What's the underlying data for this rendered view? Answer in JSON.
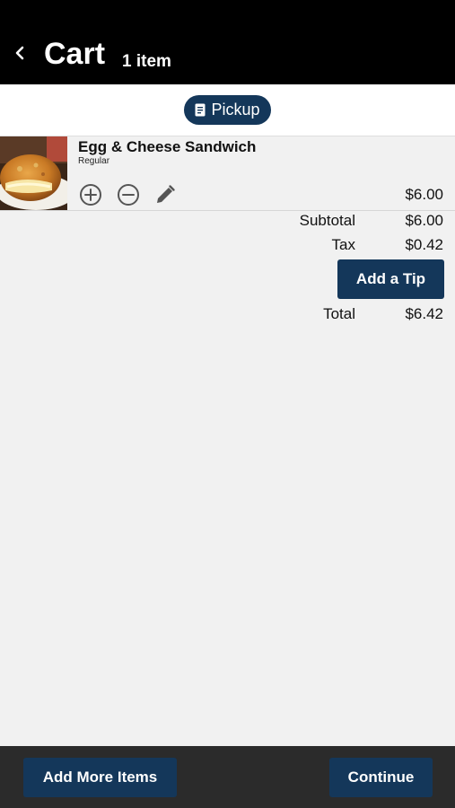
{
  "header": {
    "title": "Cart",
    "item_count": "1 item"
  },
  "mode": {
    "label": "Pickup",
    "icon": "receipt-icon"
  },
  "cart_item": {
    "name": "Egg & Cheese Sandwich",
    "variant": "Regular",
    "price": "$6.00"
  },
  "summary": {
    "subtotal_label": "Subtotal",
    "subtotal_value": "$6.00",
    "tax_label": "Tax",
    "tax_value": "$0.42",
    "tip_button": "Add a Tip",
    "total_label": "Total",
    "total_value": "$6.42"
  },
  "footer": {
    "add_more": "Add More Items",
    "continue": "Continue"
  },
  "colors": {
    "header_bg": "#000000",
    "accent": "#14375a",
    "page_bg": "#f1f1f1",
    "footer_bg": "#2b2b2b"
  }
}
